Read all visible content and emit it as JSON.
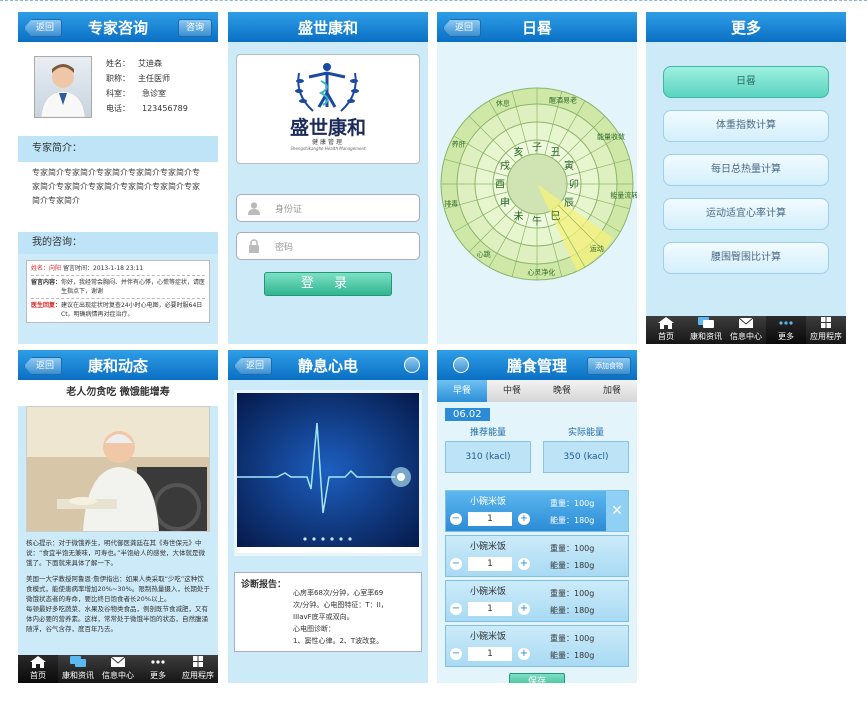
{
  "colors": {
    "header_blue": "#0a6fc4",
    "bg_light": "#cdeaf8",
    "tabbar": "#222222",
    "green": "#2fb68f"
  },
  "tabbar": {
    "items": [
      {
        "label": "首页",
        "icon": "home-icon"
      },
      {
        "label": "康和资讯",
        "icon": "chat-icon"
      },
      {
        "label": "信息中心",
        "icon": "mail-icon"
      },
      {
        "label": "更多",
        "icon": "more-icon"
      },
      {
        "label": "应用程序",
        "icon": "grid-icon"
      }
    ]
  },
  "expert": {
    "title": "专家咨询",
    "back": "返回",
    "consult": "咨询",
    "name_label": "姓名：",
    "name": "艾迪森",
    "title_label": "职称：",
    "title_value": "主任医师",
    "dept_label": "科室：",
    "dept": "急诊室",
    "phone_label": "电话：",
    "phone": "123456789",
    "intro_header": "专家简介：",
    "intro_text": "专家简介专家简介专家简介专家简介专家简介专家简介专家简介专家简介专家简介专家简介专家简介专家简介",
    "my_consult": "我的咨询：",
    "msg_name": "姓名：向阳",
    "msg_time": "留言时间：2013-1-18 23:11",
    "msg_label": "留言内容：",
    "msg_text": "你好，我经常会胸闷、并伴有心悸，心慌等症状，请医生指点下，谢谢",
    "reply_label": "医生回复：",
    "reply_text": "建议在出现症状时复查24小时心电图，必要时服64日Ct，明确病情再对症治疗。"
  },
  "login": {
    "title": "盛世康和",
    "brand": "盛世康和",
    "sub": "健康管理",
    "en": "Shengshikanghe Health Management",
    "id_placeholder": "身份证",
    "pwd_placeholder": "密码",
    "login_btn": "登 录"
  },
  "sundial": {
    "title": "日晷",
    "back": "返回",
    "center_chars": [
      "子",
      "丑",
      "寅",
      "卯",
      "辰",
      "巳",
      "午",
      "未",
      "申",
      "酉",
      "戌",
      "亥"
    ],
    "outer": [
      "醒酒易老",
      "能量收敛",
      "能量流转",
      "运动",
      "心灵净化",
      "心跳",
      "排毒",
      "养肝",
      "休息"
    ]
  },
  "more": {
    "title": "更多",
    "items": [
      "日晷",
      "体重指数计算",
      "每日总热量计算",
      "运动适宜心率计算",
      "腰围臀围比计算"
    ]
  },
  "news": {
    "title": "康和动态",
    "back": "返回",
    "headline": "老人勿贪吃 微饿能增寿",
    "p1": "核心提示：对于微饿养生，明代御医龚廷在其《寿世保元》中说：“食宜半饱无兼味，可寿也。”半饱给人的感觉，大体就是微饿了。下面就来具体了解一下。",
    "p2": "美国一大学教授阿鲁恩·詹伊指出：如果人类采取“少吃”这种饮食模式，能使患病率增加20%~30%。限制热量摄入，长期处于微饿状态者的寿命，要比终日饱食者长20%以上。",
    "p3": "每顿最好多吃蔬菜、水果及谷物类食品，例剖既节食减肥，又有体内必要的营养素。这样，常常处于微饿半饱的状态，自然腹涌随浮，谷气含存，度百年乃去。"
  },
  "ecg": {
    "title": "静息心电",
    "back": "返回",
    "report_title": "诊断报告：",
    "line1": "心房率68次/分钟，心室率69",
    "line2": "次/分钟。心电图特征：T：II，",
    "line3": "IIIavF底平或双向。",
    "diag_label": "心电图诊断：",
    "diag": "1、窦性心律。2、T波改变。"
  },
  "diet": {
    "title": "膳食管理",
    "add": "添加食物",
    "tabs": [
      "早餐",
      "中餐",
      "晚餐",
      "加餐"
    ],
    "date": "06.02",
    "rec_label": "推荐能量",
    "rec_value": "310 (kacl)",
    "act_label": "实际能量",
    "act_value": "350 (kacl)",
    "foods": [
      {
        "name": "小碗米饭",
        "qty": "1",
        "weight": "重量：100g",
        "energy": "能量：180g"
      },
      {
        "name": "小碗米饭",
        "qty": "1",
        "weight": "重量：100g",
        "energy": "能量：180g"
      },
      {
        "name": "小碗米饭",
        "qty": "1",
        "weight": "重量：100g",
        "energy": "能量：180g"
      },
      {
        "name": "小碗米饭",
        "qty": "1",
        "weight": "重量：100g",
        "energy": "能量：180g"
      }
    ],
    "save": "保存"
  }
}
